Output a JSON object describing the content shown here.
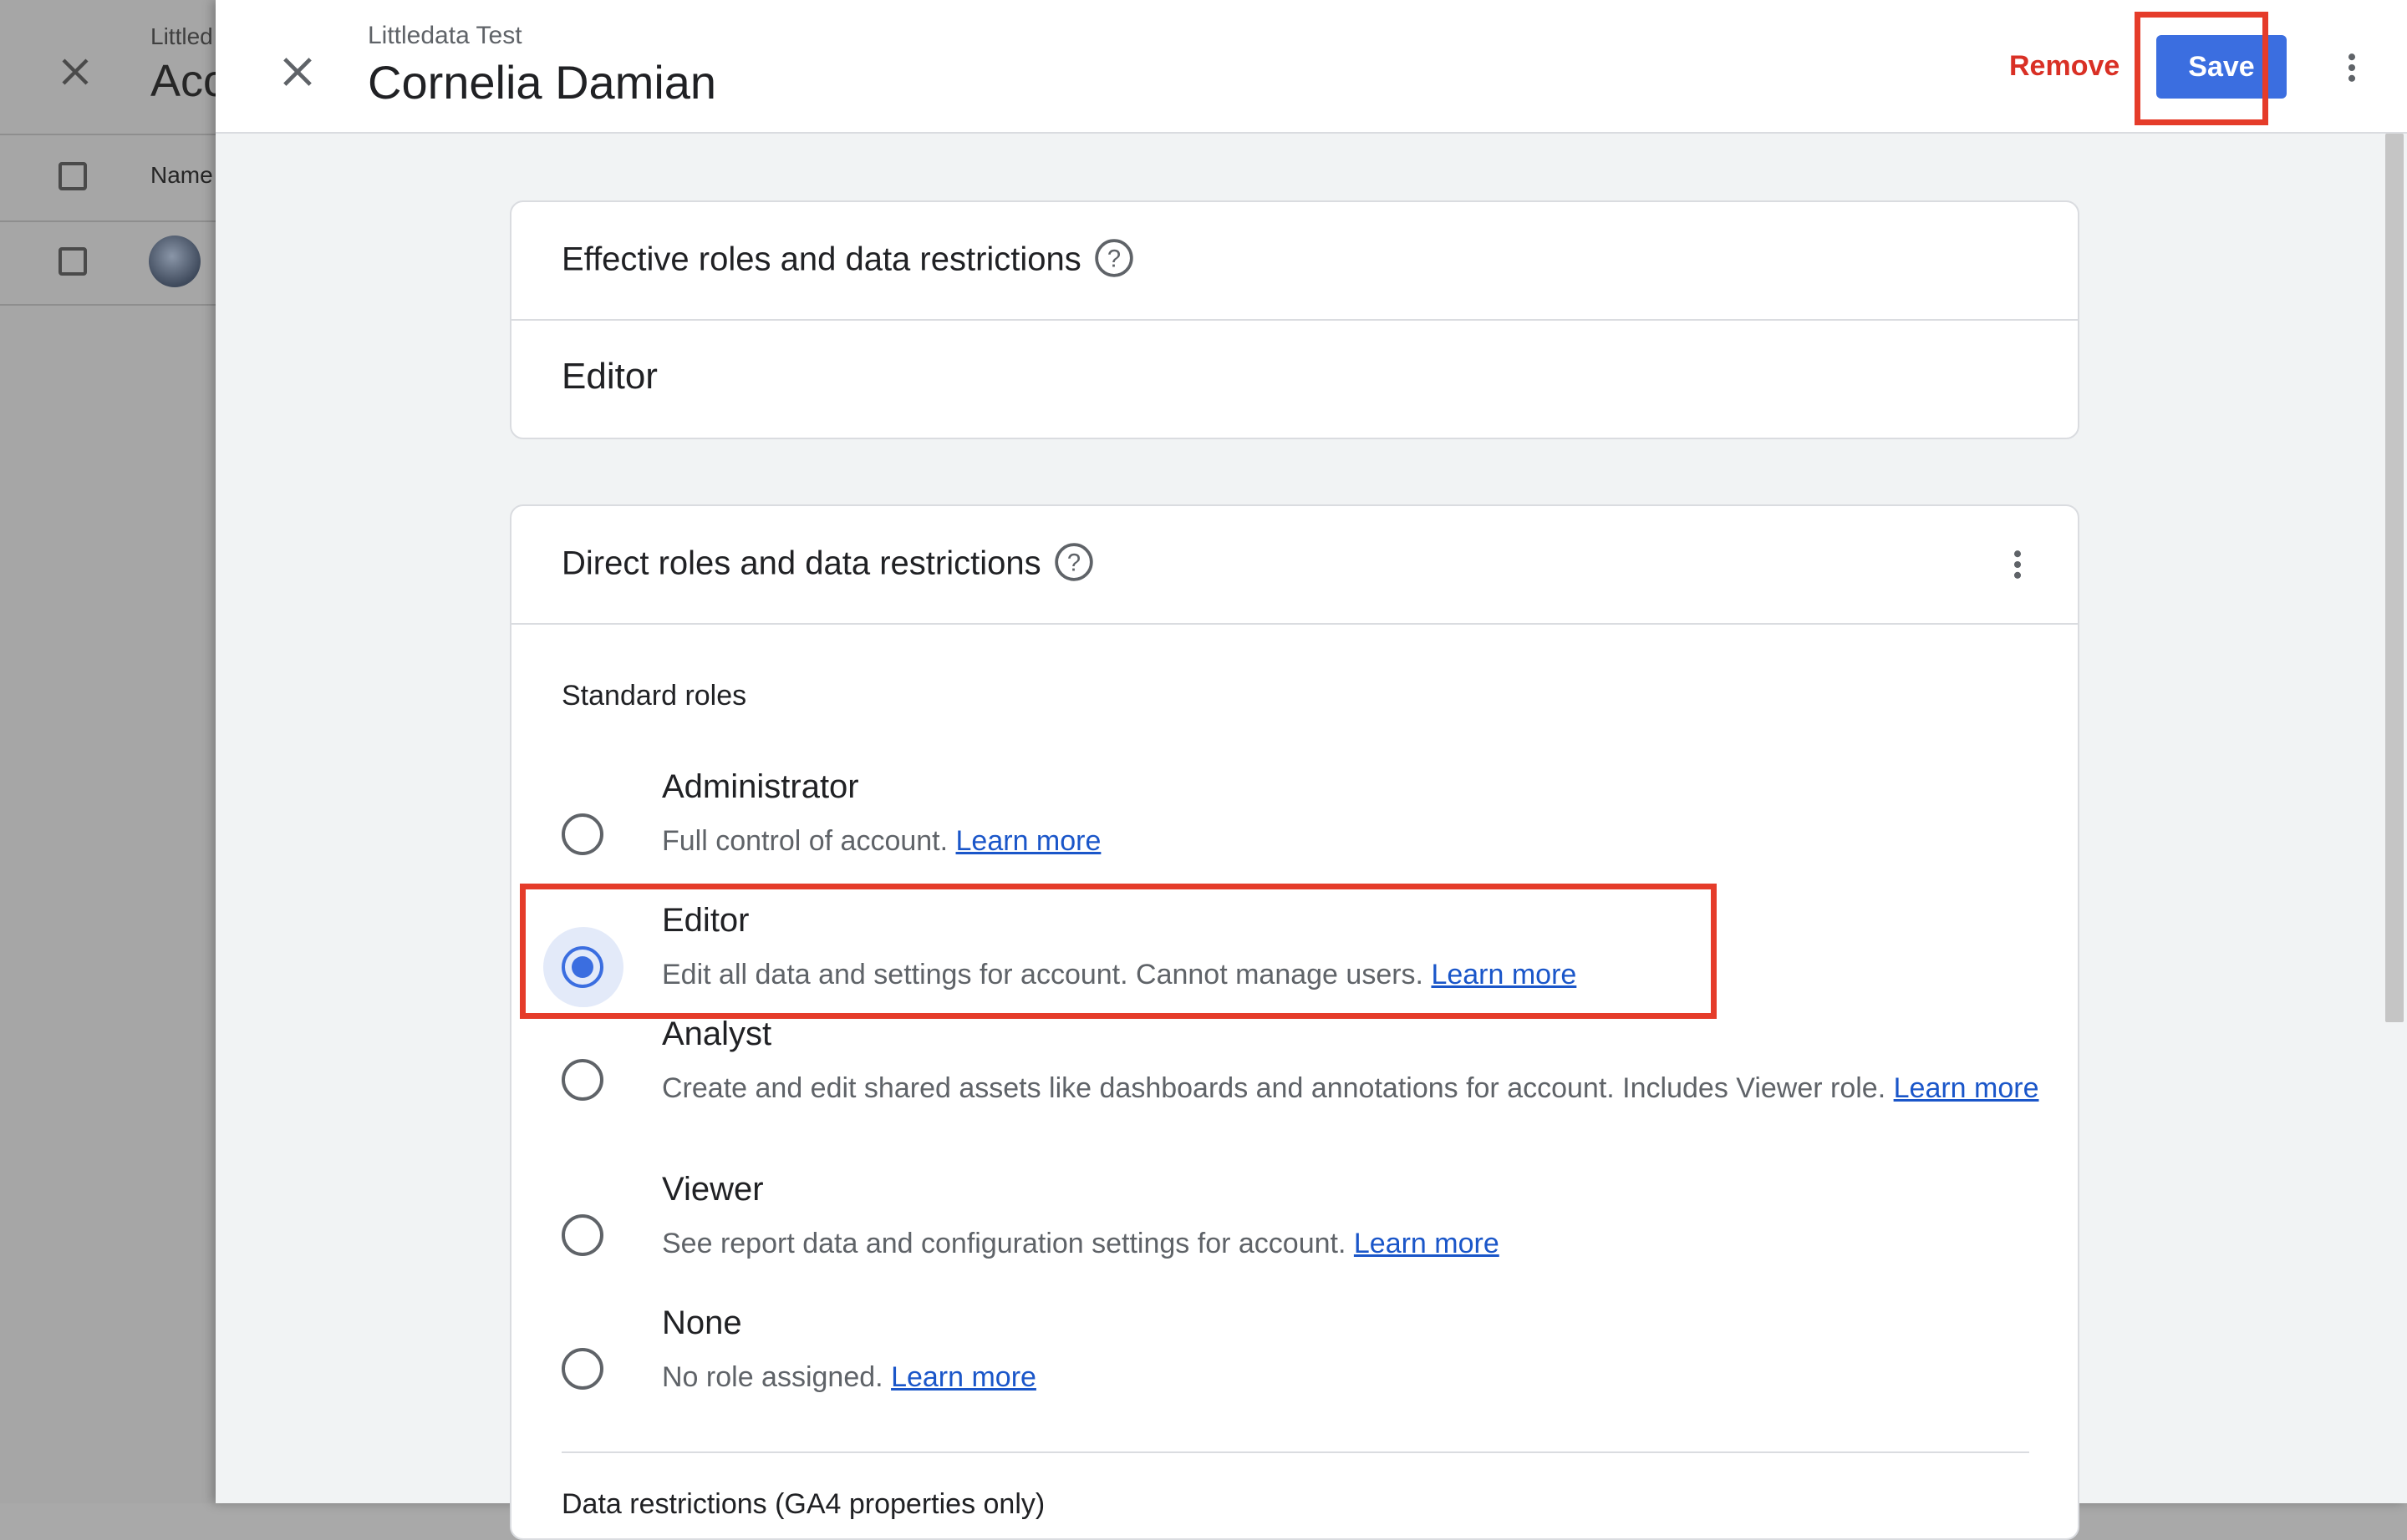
{
  "background_page": {
    "subtitle": "Littled",
    "title": "Acc",
    "column_name": "Name"
  },
  "drawer": {
    "subtitle": "Littledata Test",
    "title": "Cornelia Damian",
    "remove_label": "Remove",
    "save_label": "Save"
  },
  "effective_card": {
    "title": "Effective roles and data restrictions",
    "value": "Editor"
  },
  "direct_card": {
    "title": "Direct roles and data restrictions",
    "section_label": "Standard roles",
    "roles": [
      {
        "name": "Administrator",
        "description": "Full control of account.",
        "link": "Learn more",
        "selected": false
      },
      {
        "name": "Editor",
        "description": "Edit all data and settings for account. Cannot manage users.",
        "link": "Learn more",
        "selected": true
      },
      {
        "name": "Analyst",
        "description": "Create and edit shared assets like dashboards and annotations for account. Includes Viewer role.",
        "link": "Learn more",
        "selected": false
      },
      {
        "name": "Viewer",
        "description": "See report data and configuration settings for account.",
        "link": "Learn more",
        "selected": false
      },
      {
        "name": "None",
        "description": "No role assigned.",
        "link": "Learn more",
        "selected": false
      }
    ],
    "next_section_label": "Data restrictions (GA4 properties only)"
  },
  "colors": {
    "accent": "#3b6ee0",
    "remove": "#d93025",
    "highlight": "#e53c2a"
  },
  "icons": [
    "close-icon",
    "help-icon",
    "more-vert-icon",
    "radio-icon"
  ]
}
